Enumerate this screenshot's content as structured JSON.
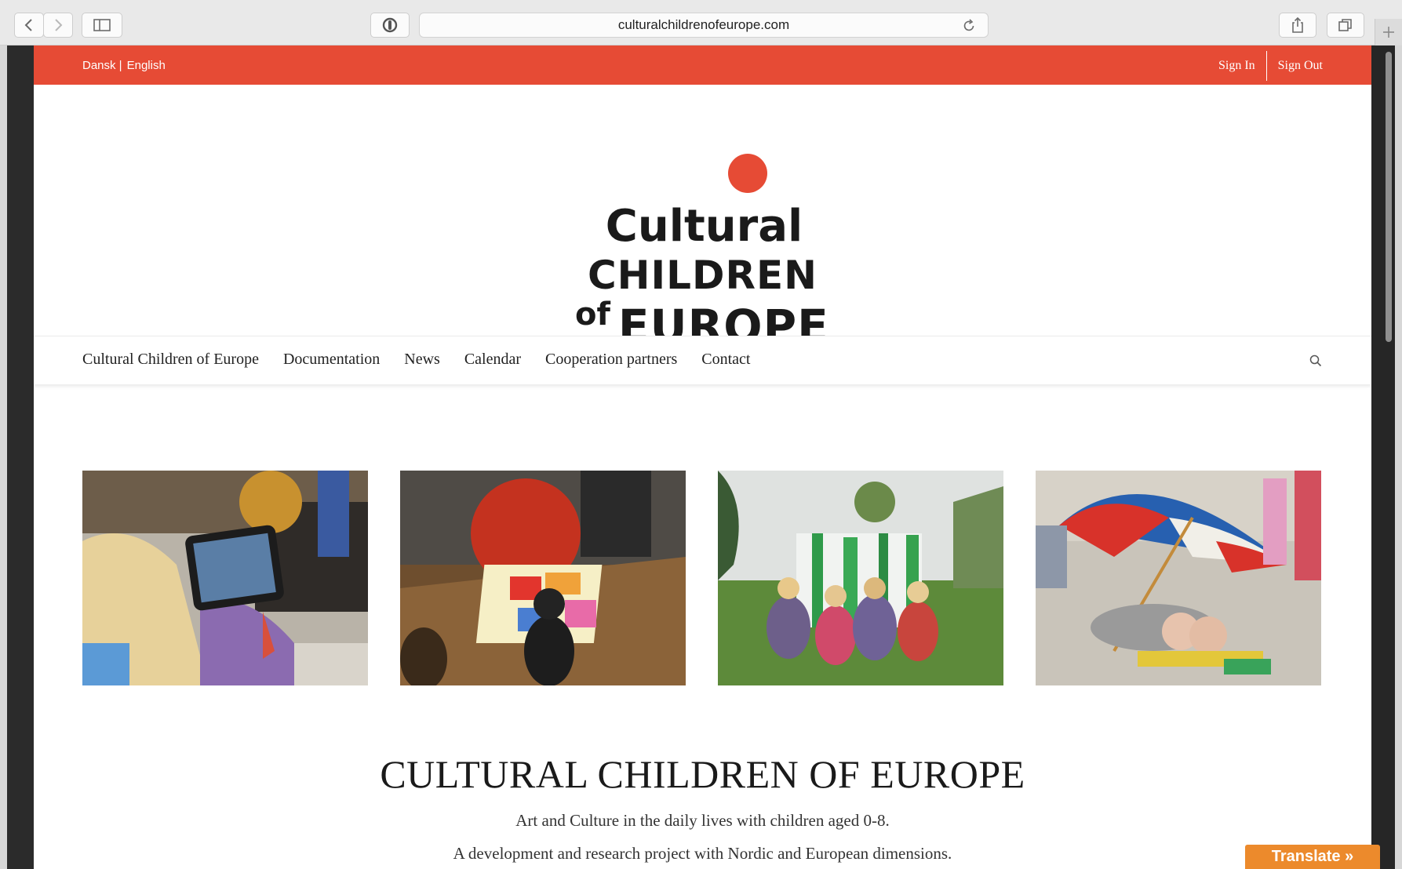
{
  "browser": {
    "url": "culturalchildrenofeurope.com"
  },
  "topbar": {
    "lang_dansk": "Dansk |",
    "lang_english": "English",
    "sign_in": "Sign In",
    "sign_out": "Sign Out"
  },
  "logo": {
    "line1": "Cultural",
    "line2": "CHILDREN",
    "line3_small": "of",
    "line3_big": "EUROPE"
  },
  "nav": {
    "items": [
      "Cultural Children of Europe",
      "Documentation",
      "News",
      "Calendar",
      "Cooperation partners",
      "Contact"
    ]
  },
  "hero": {
    "title": "CULTURAL CHILDREN OF EUROPE",
    "line1": "Art and Culture in the daily lives with children aged 0-8.",
    "line2": "A development and research project with Nordic and European dimensions."
  },
  "translate_label": "Translate »",
  "colors": {
    "accent": "#e64b35",
    "translate": "#ec8a2c"
  },
  "icons": [
    "back-icon",
    "forward-icon",
    "sidebar-icon",
    "shield-icon",
    "reload-icon",
    "share-icon",
    "tabs-icon",
    "search-icon"
  ]
}
